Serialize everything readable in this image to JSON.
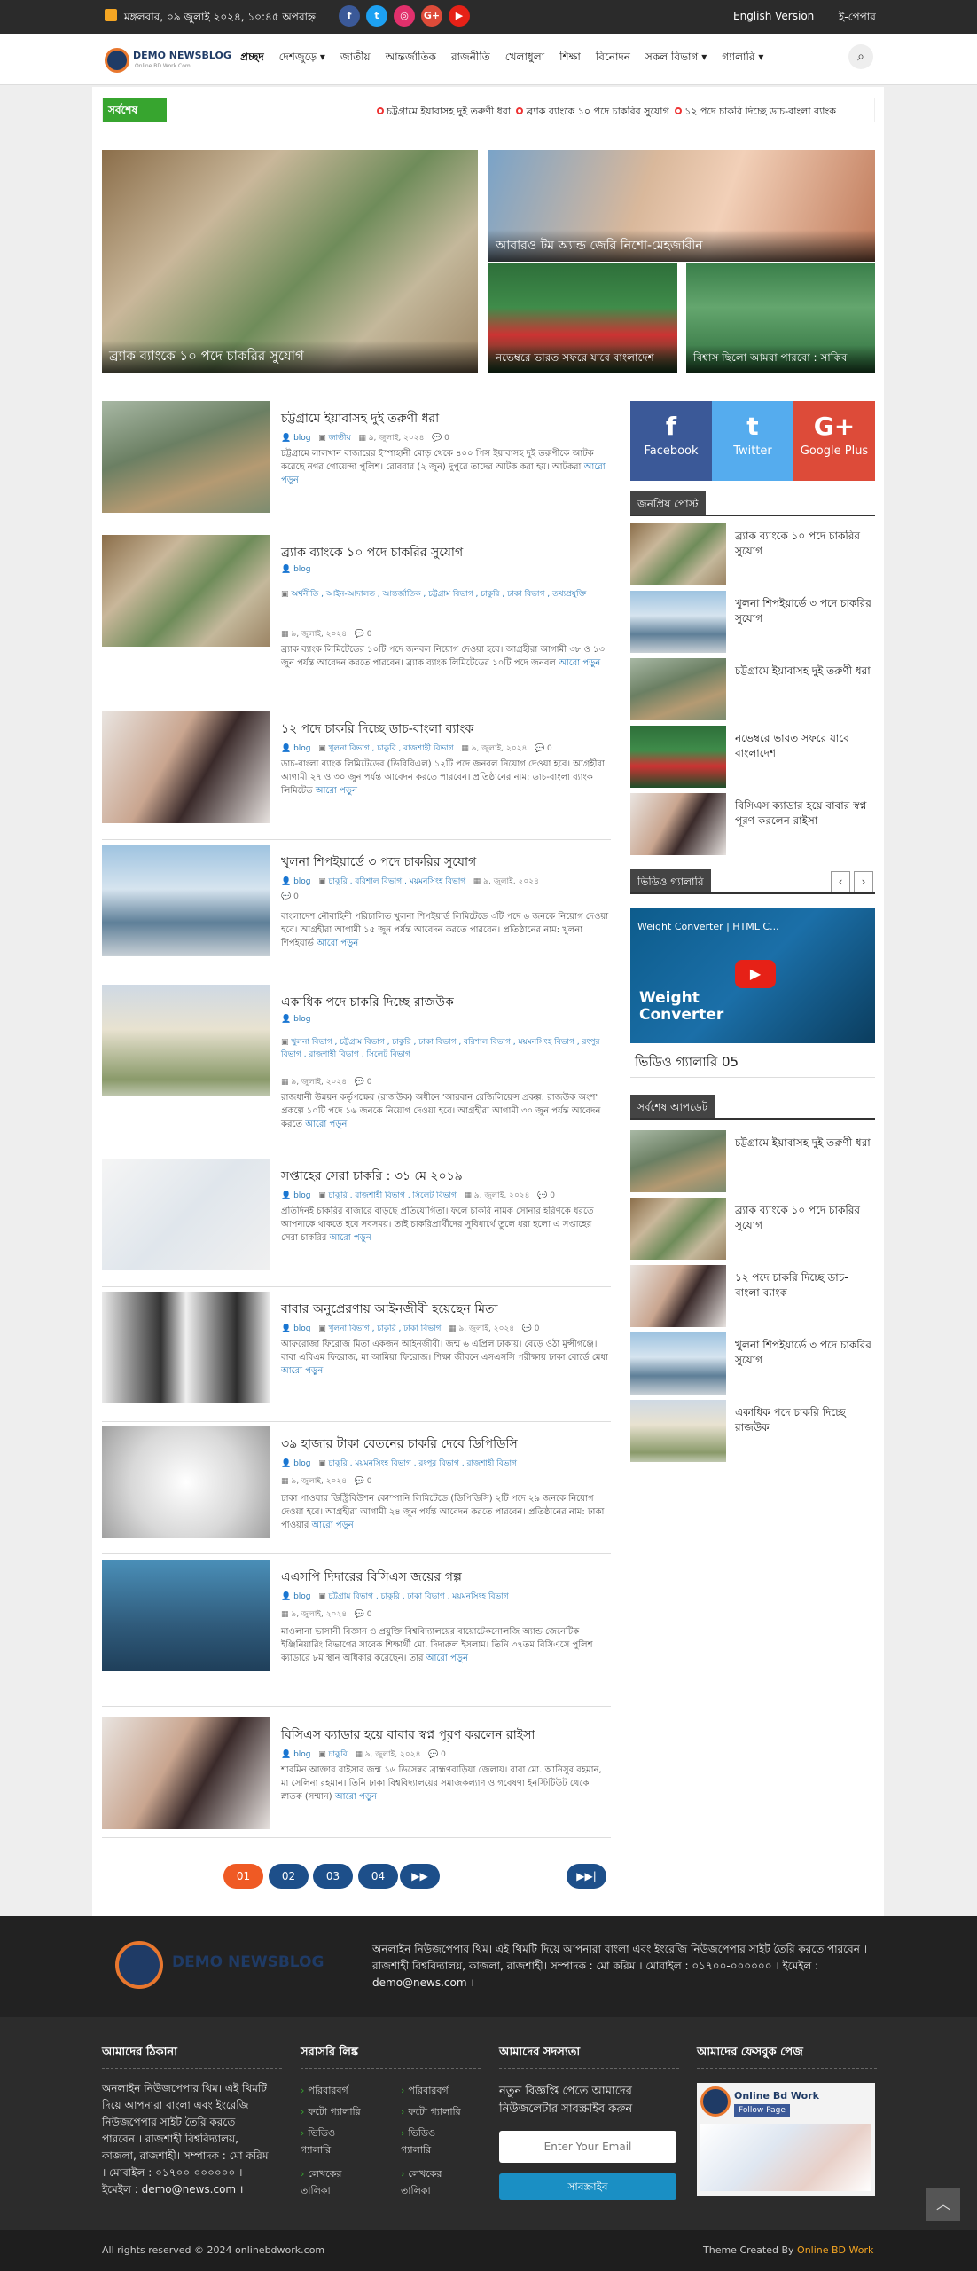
{
  "topbar": {
    "date": "মঙ্গলবার, ০৯ জুলাই ২০২৪, ১০:৪৫ অপরাহ্ন",
    "social": [
      {
        "icon": "facebook-icon",
        "glyph": "f",
        "color": "#3b5998"
      },
      {
        "icon": "twitter-icon",
        "glyph": "t",
        "color": "#1da1f2"
      },
      {
        "icon": "instagram-icon",
        "glyph": "◎",
        "color": "#e1306c"
      },
      {
        "icon": "google-plus-icon",
        "glyph": "G+",
        "color": "#dd4b39"
      },
      {
        "icon": "youtube-icon",
        "glyph": "▶",
        "color": "#e62117"
      }
    ],
    "english_version": "English Version",
    "epaper": "ই-পেপার"
  },
  "header": {
    "logo_title": "DEMO NEWSBLOG",
    "logo_tagline": "Online BD Work Com",
    "nav": [
      "প্রচ্ছদ",
      "দেশজুড়ে ▾",
      "জাতীয়",
      "আন্তর্জাতিক",
      "রাজনীতি",
      "খেলাধুলা",
      "শিক্ষা",
      "বিনোদন",
      "সকল বিভাগ ▾",
      "গ্যালারি ▾"
    ]
  },
  "breaking": {
    "label": "সর্বশেষ",
    "items": [
      "চট্টগ্রামে ইয়াবাসহ দুই তরুণী ধরা",
      "ব্র্যাক ব্যাংকে ১০ পদে চাকরির সুযোগ",
      "১২ পদে চাকরি দিচ্ছে ডাচ-বাংলা ব্যাংক"
    ]
  },
  "hero": [
    {
      "caption": "ব্র্যাক ব্যাংকে ১০ পদে চাকরির সুযোগ"
    },
    {
      "caption": "আবারও টম অ্যান্ড জেরি নিশো-মেহজাবীন"
    },
    {
      "caption": "নভেম্বরে ভারত সফরে যাবে বাংলাদেশ"
    },
    {
      "caption": "বিশ্বাস ছিলো আমরা পারবো : সাকিব"
    }
  ],
  "posts": [
    {
      "title": "চট্টগ্রামে ইয়াবাসহ দুই তরুণী ধরা",
      "author": "blog",
      "cats": "জাতীয়",
      "date": "৯, জুলাই, ২০২৪",
      "comments": "0",
      "excerpt": "চট্টগ্রামে লালখান বাজারের ইস্পাহানী মোড় থেকে ৪০০ পিস ইয়াবাসহ দুই তরুণীকে আটক করেছে নগর গোয়েন্দা পুলিশ। রোববার (২ জুন) দুপুরে তাদের আটক করা হয়। আটকরা",
      "more": "আরো পড়ুন"
    },
    {
      "title": "ব্র্যাক ব্যাংকে ১০ পদে চাকরির সুযোগ",
      "author": "blog",
      "cats": "অর্থনীতি , আইন-আদালত , আন্তর্জাতিক , চট্টগ্রাম বিভাগ , চাকুরি , ঢাকা বিভাগ , তথ্যপ্রযুক্তি",
      "date": "৯, জুলাই, ২০২৪",
      "comments": "0",
      "excerpt": "ব্র্যাক ব্যাংক লিমিটেডের ১০টি পদে জনবল নিয়োগ দেওয়া হবে। আগ্রহীরা আগামী ৩৮ ও ১৩ জুন পর্যন্ত আবেদন করতে পারবেন। ব্র্যাক ব্যাংক লিমিটেডের ১০টি পদে জনবল",
      "more": "আরো পড়ুন"
    },
    {
      "title": "১২ পদে চাকরি দিচ্ছে ডাচ-বাংলা ব্যাংক",
      "author": "blog",
      "cats": "খুলনা বিভাগ , চাকুরি , রাজশাহী বিভাগ",
      "date": "৯, জুলাই, ২০২৪",
      "comments": "0",
      "excerpt": "ডাচ-বাংলা ব্যাংক লিমিটেডের (ডিবিবিএল) ১২টি পদে জনবল নিয়োগ দেওয়া হবে। আগ্রহীরা আগামী ২৭ ও ৩০ জুন পর্যন্ত আবেদন করতে পারবেন। প্রতিষ্ঠানের নাম: ডাচ-বাংলা ব্যাংক লিমিটেড",
      "more": "আরো পড়ুন"
    },
    {
      "title": "খুলনা শিপইয়ার্ডে ৩ পদে চাকরির সুযোগ",
      "author": "blog",
      "cats": "চাকুরি , বরিশাল বিভাগ , ময়মনসিংহ বিভাগ",
      "date": "৯, জুলাই, ২০২৪",
      "comments": "0",
      "excerpt": "বাংলাদেশ নৌবাহিনী পরিচালিত খুলনা শিপইয়ার্ড লিমিটেডে ৩টি পদে ৬ জনকে নিয়োগ দেওয়া হবে। আগ্রহীরা আগামী ১৫ জুন পর্যন্ত আবেদন করতে পারবেন। প্রতিষ্ঠানের নাম: খুলনা শিপইয়ার্ড",
      "more": "আরো পড়ুন"
    },
    {
      "title": "একাধিক পদে চাকরি দিচ্ছে রাজউক",
      "author": "blog",
      "cats": "খুলনা বিভাগ , চট্টগ্রাম বিভাগ , চাকুরি , ঢাকা বিভাগ , বরিশাল বিভাগ , ময়মনসিংহ বিভাগ , রংপুর বিভাগ , রাজশাহী বিভাগ , সিলেট বিভাগ",
      "date": "৯, জুলাই, ২০২৪",
      "comments": "0",
      "excerpt": "রাজধানী উন্নয়ন কর্তৃপক্ষের (রাজউক) অধীনে 'আরবান রেজিলিয়েন্স প্রকল্প: রাজউক অংশ' প্রকল্পে ১০টি পদে ১৬ জনকে নিয়োগ দেওয়া হবে। আগ্রহীরা আগামী ৩০ জুন পর্যন্ত আবেদন করতে",
      "more": "আরো পড়ুন"
    },
    {
      "title": "সপ্তাহের সেরা চাকরি : ৩১ মে ২০১৯",
      "author": "blog",
      "cats": "চাকুরি , রাজশাহী বিভাগ , সিলেট বিভাগ",
      "date": "৯, জুলাই, ২০২৪",
      "comments": "0",
      "excerpt": "প্রতিদিনই চাকরির বাজারে বাড়ছে প্রতিযোগিতা। ফলে চাকরি নামক সোনার হরিণকে ধরতে আপনাকে থাকতে হবে সবসময়। তাই চাকরিপ্রার্থীদের সুবিধার্থে তুলে ধরা হলো এ সপ্তাহের সেরা চাকরির",
      "more": "আরো পড়ুন"
    },
    {
      "title": "বাবার অনুপ্রেরণায় আইনজীবী হয়েছেন মিতা",
      "author": "blog",
      "cats": "খুলনা বিভাগ , চাকুরি , ঢাকা বিভাগ",
      "date": "৯, জুলাই, ২০২৪",
      "comments": "0",
      "excerpt": "আফরোজা ফিরোজ মিতা একজন আইনজীবী। জন্ম ৬ এপ্রিল ঢাকায়। বেড়ে ওঠা মুন্সীগঞ্জে। বাবা এবিএম ফিরোজ, মা আমিয়া ফিরোজ। শিক্ষা জীবনে এসএসসি পরীক্ষায় ঢাকা বোর্ডে মেধা",
      "more": "আরো পড়ুন"
    },
    {
      "title": "৩৯ হাজার টাকা বেতনের চাকরি দেবে ডিপিডিসি",
      "author": "blog",
      "cats": "চাকুরি , ময়মনসিংহ বিভাগ , রংপুর বিভাগ , রাজশাহী বিভাগ",
      "date": "৯, জুলাই, ২০২৪",
      "comments": "0",
      "excerpt": "ঢাকা পাওয়ার ডিস্ট্রিবিউশন কোম্পানি লিমিটেডে (ডিপিডিসি) ২টি পদে ২৯ জনকে নিয়োগ দেওয়া হবে। আগ্রহীরা আগামী ২৪ জুন পর্যন্ত আবেদন করতে পারবেন। প্রতিষ্ঠানের নাম: ঢাকা পাওয়ার",
      "more": "আরো পড়ুন"
    },
    {
      "title": "এএসপি দিদারের বিসিএস জয়ের গল্প",
      "author": "blog",
      "cats": "চট্টগ্রাম বিভাগ , চাকুরি , ঢাকা বিভাগ , ময়মনসিংহ বিভাগ",
      "date": "৯, জুলাই, ২০২৪",
      "comments": "0",
      "excerpt": "মাওলানা ভাসানী বিজ্ঞান ও প্রযুক্তি বিশ্ববিদ্যালয়ের বায়োটেকনোলজি অ্যান্ড জেনেটিক ইঞ্জিনিয়ারিং বিভাগের সাবেক শিক্ষার্থী মো. দিদারুল ইসলাম। তিনি ৩৭তম বিসিএসে পুলিশ ক্যাডারে ৮ম স্থান অধিকার করেছেন। তার",
      "more": "আরো পড়ুন"
    },
    {
      "title": "বিসিএস ক্যাডার হয়ে বাবার স্বপ্ন পূরণ করলেন রাইসা",
      "author": "blog",
      "cats": "চাকুরি",
      "date": "৯, জুলাই, ২০২৪",
      "comments": "0",
      "excerpt": "শারমিন আক্তার রাইসার জন্ম ১৬ ডিসেম্বর ব্রাহ্মণবাড়িয়া জেলায়। বাবা মো. আনিসুর রহমান, মা সেলিনা রহমান। তিনি ঢাকা বিশ্ববিদ্যালয়ের সমাজকল্যাণ ও গবেষণা ইনস্টিটিউট থেকে স্নাতক (সম্মান)",
      "more": "আরো পড়ুন"
    }
  ],
  "pagination": [
    "01",
    "02",
    "03",
    "04",
    "▶▶",
    "▶▶|"
  ],
  "sidebar": {
    "social": [
      {
        "glyph": "f",
        "label": "Facebook",
        "color": "#3b5998"
      },
      {
        "glyph": "t",
        "label": "Twitter",
        "color": "#55acee"
      },
      {
        "glyph": "G+",
        "label": "Google Plus",
        "color": "#dd4b39"
      }
    ],
    "popular_title": "জনপ্রিয় পোস্ট",
    "popular": [
      "ব্র্যাক ব্যাংকে ১০ পদে চাকরির সুযোগ",
      "খুলনা শিপইয়ার্ডে ৩ পদে চাকরির সুযোগ",
      "চট্টগ্রামে ইয়াবাসহ দুই তরুণী ধরা",
      "নভেম্বরে ভারত সফরে যাবে বাংলাদেশ",
      "বিসিএস ক্যাডার হয়ে বাবার স্বপ্ন পূরণ করলেন রাইসা"
    ],
    "video_title": "ভিডিও গ্যালারি",
    "video_overlay_title": "Weight Converter | HTML C...",
    "video_big_text": "Weight Converter",
    "video_caption": "ভিডিও গ্যালারি 05",
    "latest_title": "সর্বশেষ আপডেট",
    "latest": [
      "চট্টগ্রামে ইয়াবাসহ দুই তরুণী ধরা",
      "ব্র্যাক ব্যাংকে ১০ পদে চাকরির সুযোগ",
      "১২ পদে চাকরি দিচ্ছে ডাচ-বাংলা ব্যাংক",
      "খুলনা শিপইয়ার্ডে ৩ পদে চাকরির সুযোগ",
      "একাধিক পদে চাকরি দিচ্ছে রাজউক"
    ]
  },
  "footer": {
    "logo_title": "DEMO NEWSBLOG",
    "about": "অনলাইন নিউজপেপার থিম। এই থিমটি দিয়ে আপনারা বাংলা এবং ইংরেজি নিউজপেপার সাইট তৈরি করতে পারবেন । রাজশাহী বিশ্ববিদ্যালয়, কাজলা, রাজশাহী। সম্পাদক : মো করিম । মোবাইল : ০১৭০০-০০০০০০ । ইমেইল : demo@news.com ।",
    "address_title": "আমাদের ঠিকানা",
    "address": "অনলাইন নিউজপেপার থিম। এই থিমটি দিয়ে আপনারা বাংলা এবং ইংরেজি নিউজপেপার সাইট তৈরি করতে পারবেন । রাজশাহী বিশ্ববিদ্যালয়, কাজলা, রাজশাহী। সম্পাদক : মো করিম । মোবাইল : ০১৭০০-০০০০০০ । ইমেইল : demo@news.com ।",
    "links_title": "সরাসরি লিঙ্ক",
    "links_col1": [
      "পরিবারবর্গ",
      "ফটো গ্যালারি",
      "ভিডিও গ্যালারি",
      "লেখকের তালিকা"
    ],
    "links_col2": [
      "পরিবারবর্গ",
      "ফটো গ্যালারি",
      "ভিডিও গ্যালারি",
      "লেখকের তালিকা"
    ],
    "subscribe_title": "আমাদের সদস্যতা",
    "subscribe_text": "নতুন বিজ্ঞপ্তি পেতে আমাদের নিউজলেটার সাবস্ক্রাইব করুন",
    "email_placeholder": "Enter Your Email",
    "subscribe_btn": "সাবস্ক্রাইব",
    "fb_title": "আমাদের ফেসবুক পেজ",
    "fb_page_name": "Online Bd Work",
    "fb_follow": "Follow Page",
    "copyright": "All rights reserved © 2024 onlinebdwork.com",
    "theme_prefix": "Theme Created By ",
    "theme_by": "Online BD Work"
  }
}
